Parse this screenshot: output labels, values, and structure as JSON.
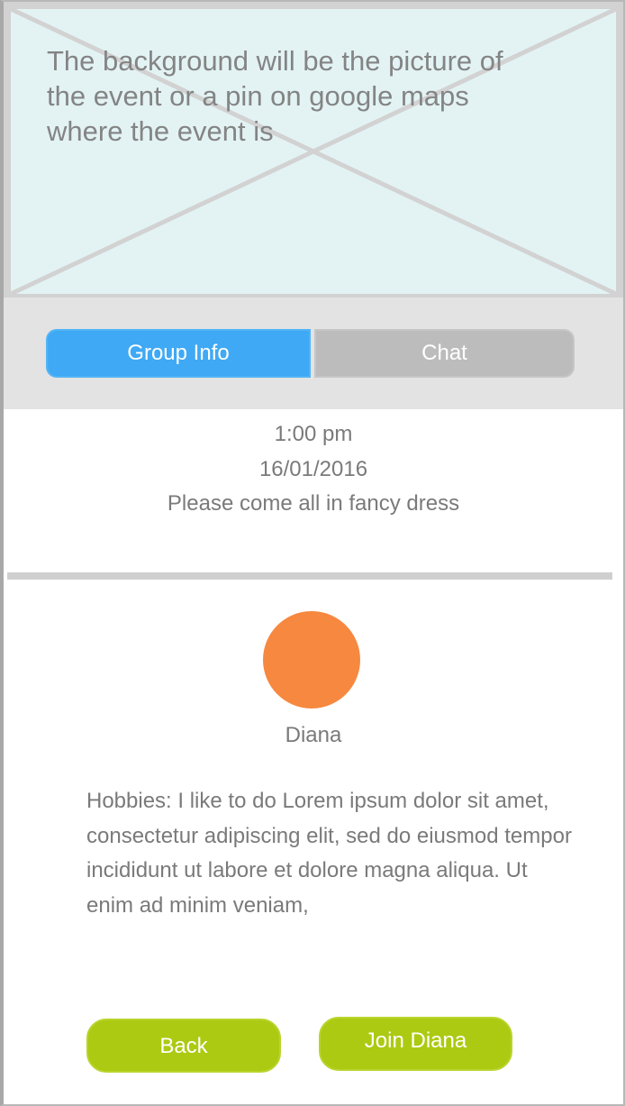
{
  "hero": {
    "placeholder_text": "The background will be the picture of the event or a pin on google maps where the event is"
  },
  "tabs": [
    {
      "label": "Group Info",
      "active": true
    },
    {
      "label": "Chat",
      "active": false
    }
  ],
  "event": {
    "time": "1:00 pm",
    "date": "16/01/2016",
    "note": "Please come all in fancy dress"
  },
  "member": {
    "name": "Diana",
    "avatar_color": "#f7883f",
    "bio": "Hobbies: I like to do Lorem ipsum dolor sit amet, consectetur adipiscing elit, sed do eiusmod tempor incididunt ut labore et dolore magna aliqua. Ut enim ad minim veniam,"
  },
  "actions": {
    "back_label": "Back",
    "join_label": "Join Diana"
  },
  "colors": {
    "active_tab": "#3fa9f5",
    "inactive_tab": "#bcbcbc",
    "action_button": "#acca12"
  }
}
